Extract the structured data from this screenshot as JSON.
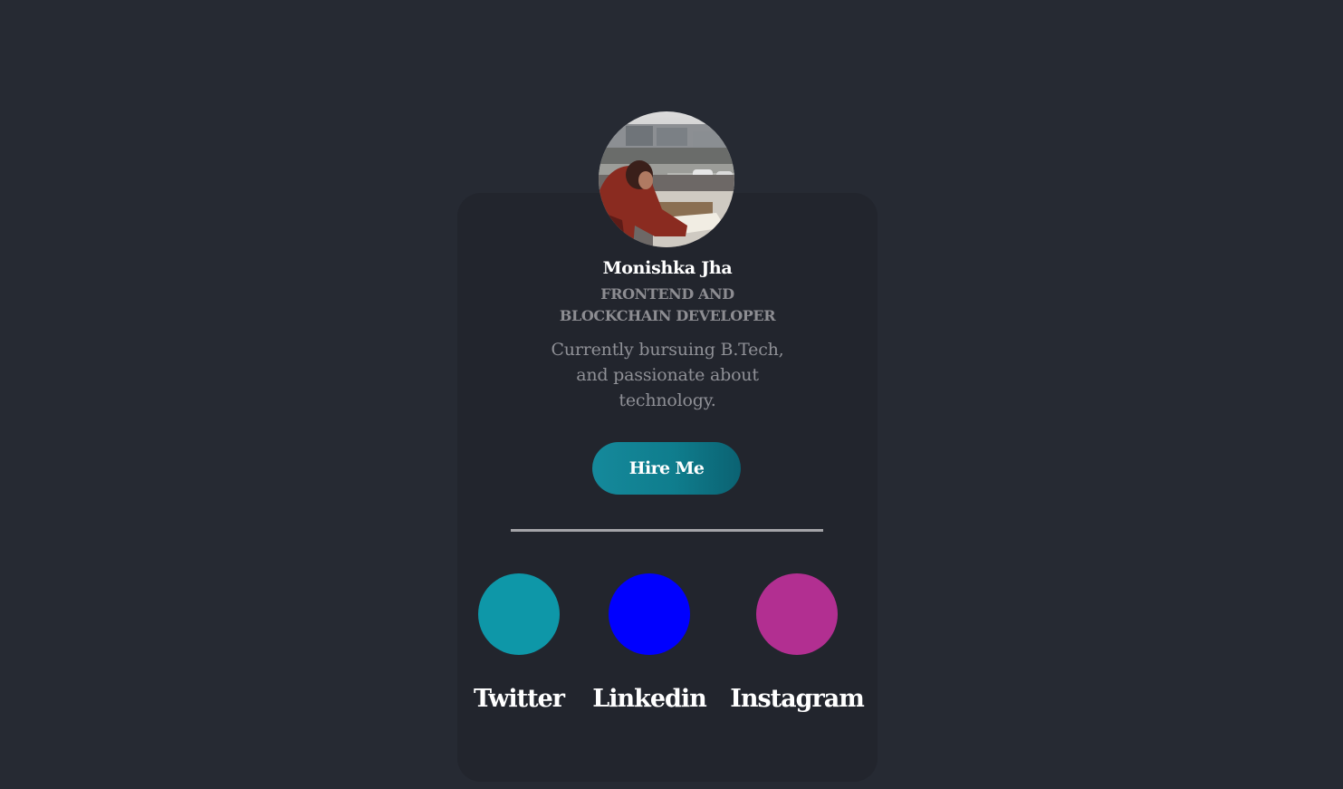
{
  "profile": {
    "name": "Monishka Jha",
    "role": "FRONTEND AND BLOCKCHAIN DEVELOPER",
    "bio": "Currently bursuing B.Tech, and passionate about technology.",
    "avatar_icon": "profile-photo"
  },
  "actions": {
    "hire_label": "Hire Me"
  },
  "social": {
    "twitter": {
      "label": "Twitter",
      "color": "#0e97a8"
    },
    "linkedin": {
      "label": "Linkedin",
      "color": "#0000ff"
    },
    "instagram": {
      "label": "Instagram",
      "color": "#b22f91"
    }
  },
  "colors": {
    "page_background": "#262a33",
    "card_background": "#22252d",
    "accent": "#128493"
  }
}
